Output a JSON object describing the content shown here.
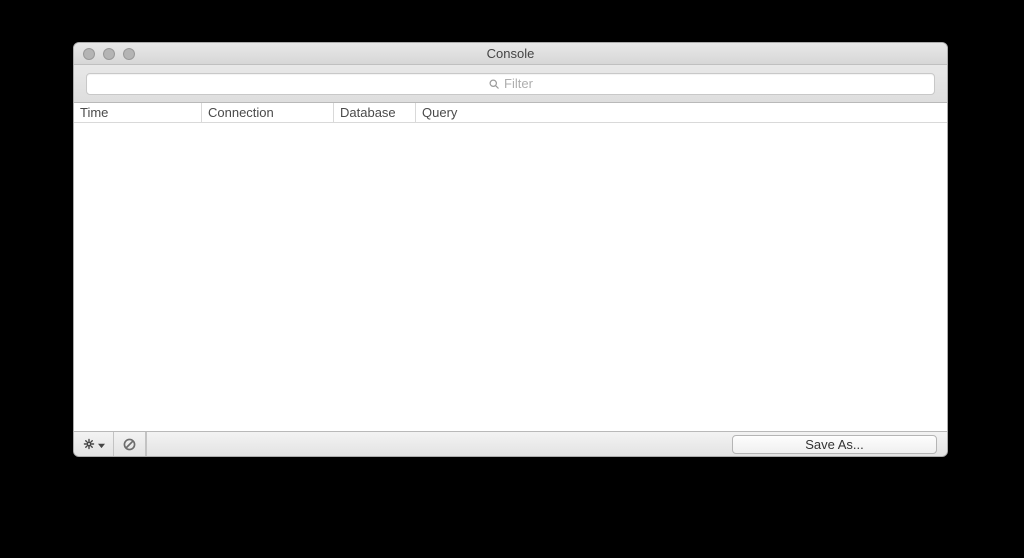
{
  "window": {
    "title": "Console"
  },
  "search": {
    "placeholder": "Filter",
    "value": ""
  },
  "columns": {
    "time": "Time",
    "connection": "Connection",
    "database": "Database",
    "query": "Query"
  },
  "rows": [],
  "footer": {
    "save_label": "Save As..."
  },
  "icons": {
    "gear": "gear-icon",
    "stop": "prohibit-icon",
    "search": "search-icon"
  }
}
